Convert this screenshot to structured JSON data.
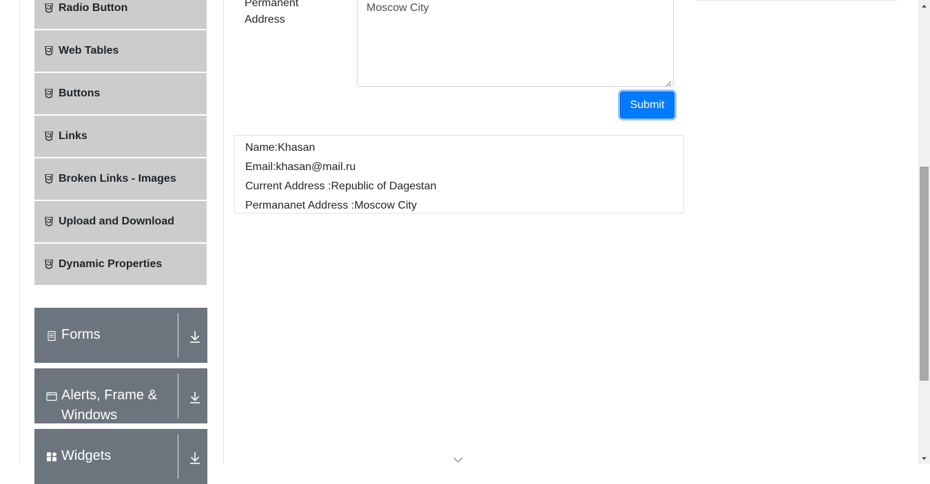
{
  "sidebar": {
    "items": [
      {
        "label": "Radio Button",
        "icon": "html5-icon"
      },
      {
        "label": "Web Tables",
        "icon": "html5-icon"
      },
      {
        "label": "Buttons",
        "icon": "html5-icon"
      },
      {
        "label": "Links",
        "icon": "html5-icon"
      },
      {
        "label": "Broken Links - Images",
        "icon": "html5-icon"
      },
      {
        "label": "Upload and Download",
        "icon": "html5-icon"
      },
      {
        "label": "Dynamic Properties",
        "icon": "html5-icon"
      }
    ],
    "groups": [
      {
        "title": "Forms",
        "icon": "document-icon"
      },
      {
        "title": "Alerts, Frame & Windows",
        "icon": "window-icon"
      },
      {
        "title": "Widgets",
        "icon": "widgets-icon"
      }
    ]
  },
  "form": {
    "permanent_address_label": "Permanent Address",
    "permanent_address_value": "Moscow City",
    "submit_label": "Submit"
  },
  "output": {
    "name": "Name:Khasan",
    "email": "Email:khasan@mail.ru",
    "current_address": "Current Address :Republic of Dagestan",
    "permanent_address": "Permananet Address :Moscow City"
  },
  "colors": {
    "menu_item_bg": "#cccccc",
    "group_header_bg": "#6c757d",
    "submit_bg": "#007bff"
  }
}
